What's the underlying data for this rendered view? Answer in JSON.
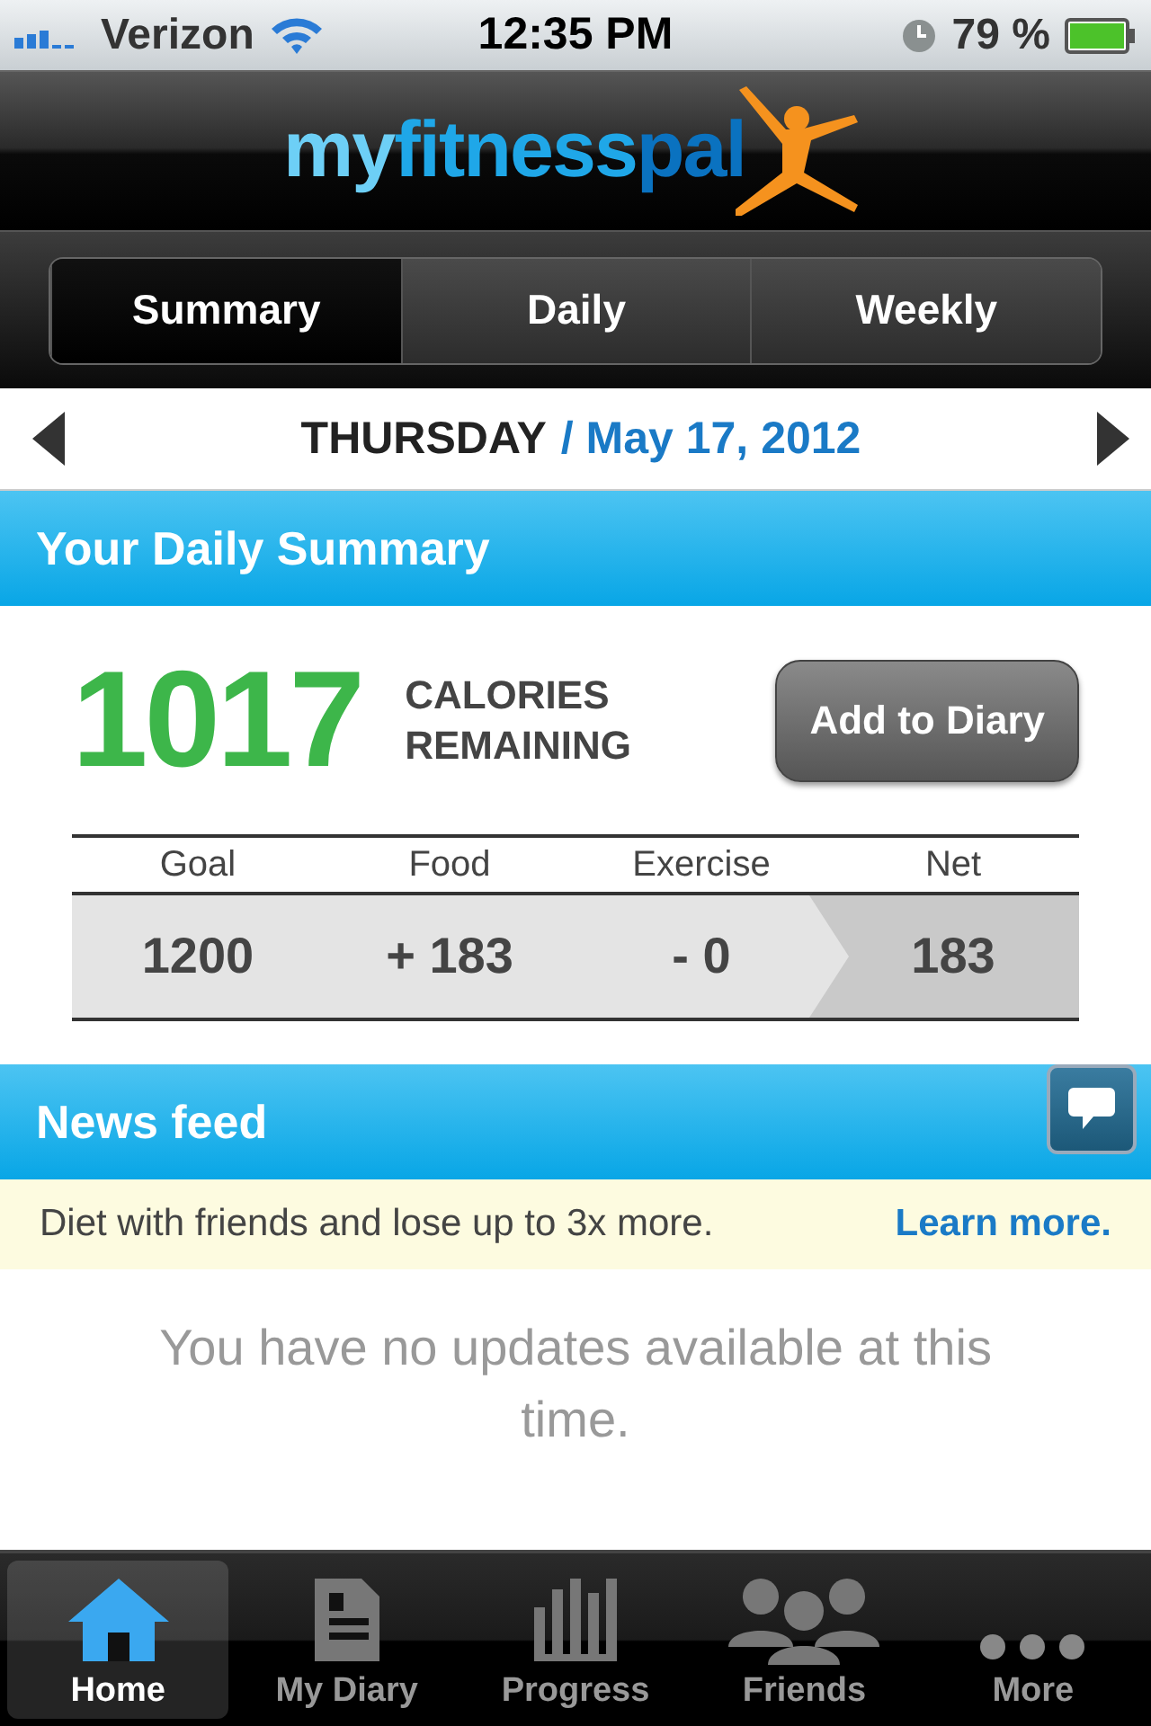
{
  "status_bar": {
    "carrier": "Verizon",
    "time": "12:35 PM",
    "battery": "79 %"
  },
  "header": {
    "logo": [
      "my",
      "fitness",
      "pal"
    ]
  },
  "segments": [
    {
      "label": "Summary",
      "selected": true
    },
    {
      "label": "Daily",
      "selected": false
    },
    {
      "label": "Weekly",
      "selected": false
    }
  ],
  "date": {
    "day": "THURSDAY",
    "date": "/ May 17, 2012"
  },
  "summary": {
    "title": "Your Daily Summary",
    "calories": "1017",
    "calories_label": "CALORIES REMAINING",
    "button": "Add to Diary",
    "columns": [
      {
        "label": "Goal",
        "value": "1200"
      },
      {
        "label": "Food",
        "value": "+ 183"
      },
      {
        "label": "Exercise",
        "value": "- 0"
      },
      {
        "label": "Net",
        "value": "183"
      }
    ]
  },
  "news": {
    "title": "News feed",
    "banner": "Diet with friends and lose up to 3x more.",
    "link": "Learn more.",
    "empty": "You have no updates available at this time."
  },
  "tab_bar": [
    {
      "label": "Home",
      "kind": "home",
      "selected": true
    },
    {
      "label": "My Diary",
      "kind": "diary",
      "selected": false
    },
    {
      "label": "Progress",
      "kind": "progress",
      "selected": false
    },
    {
      "label": "Friends",
      "kind": "friends",
      "selected": false
    },
    {
      "label": "More",
      "kind": "more",
      "selected": false
    }
  ]
}
